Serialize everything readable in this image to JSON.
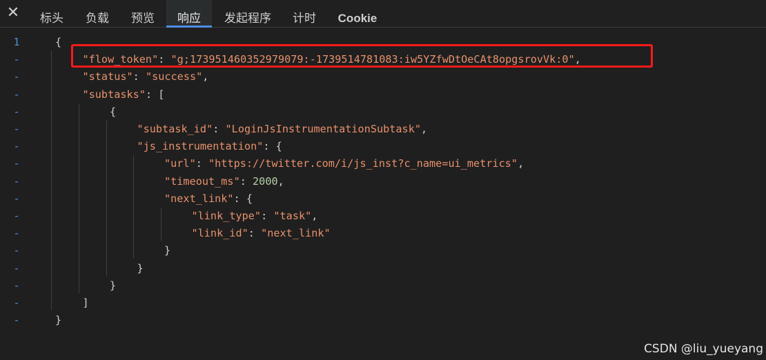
{
  "tabs": {
    "close_glyph": "✕",
    "items": [
      "标头",
      "负载",
      "预览",
      "响应",
      "发起程序",
      "计时",
      "Cookie"
    ],
    "active": "响应"
  },
  "gutter": {
    "first": "1",
    "fold": "-"
  },
  "json_lines": [
    {
      "indent": 0,
      "parts": [
        [
          "p",
          "{"
        ]
      ]
    },
    {
      "indent": 1,
      "parts": [
        [
          "k",
          "\"flow_token\""
        ],
        [
          "p",
          ": "
        ],
        [
          "s",
          "\"g;173951460352979079:-1739514781083:iw5YZfwDtOeCAt8opgsrovVk:0\""
        ],
        [
          "p",
          ","
        ]
      ]
    },
    {
      "indent": 1,
      "parts": [
        [
          "k",
          "\"status\""
        ],
        [
          "p",
          ": "
        ],
        [
          "s",
          "\"success\""
        ],
        [
          "p",
          ","
        ]
      ]
    },
    {
      "indent": 1,
      "parts": [
        [
          "k",
          "\"subtasks\""
        ],
        [
          "p",
          ": ["
        ]
      ]
    },
    {
      "indent": 2,
      "parts": [
        [
          "p",
          "{"
        ]
      ]
    },
    {
      "indent": 3,
      "parts": [
        [
          "k",
          "\"subtask_id\""
        ],
        [
          "p",
          ": "
        ],
        [
          "s",
          "\"LoginJsInstrumentationSubtask\""
        ],
        [
          "p",
          ","
        ]
      ]
    },
    {
      "indent": 3,
      "parts": [
        [
          "k",
          "\"js_instrumentation\""
        ],
        [
          "p",
          ": {"
        ]
      ]
    },
    {
      "indent": 4,
      "parts": [
        [
          "k",
          "\"url\""
        ],
        [
          "p",
          ": "
        ],
        [
          "s",
          "\"https://twitter.com/i/js_inst?c_name=ui_metrics\""
        ],
        [
          "p",
          ","
        ]
      ]
    },
    {
      "indent": 4,
      "parts": [
        [
          "k",
          "\"timeout_ms\""
        ],
        [
          "p",
          ": "
        ],
        [
          "n",
          "2000"
        ],
        [
          "p",
          ","
        ]
      ]
    },
    {
      "indent": 4,
      "parts": [
        [
          "k",
          "\"next_link\""
        ],
        [
          "p",
          ": {"
        ]
      ]
    },
    {
      "indent": 5,
      "parts": [
        [
          "k",
          "\"link_type\""
        ],
        [
          "p",
          ": "
        ],
        [
          "s",
          "\"task\""
        ],
        [
          "p",
          ","
        ]
      ]
    },
    {
      "indent": 5,
      "parts": [
        [
          "k",
          "\"link_id\""
        ],
        [
          "p",
          ": "
        ],
        [
          "s",
          "\"next_link\""
        ]
      ]
    },
    {
      "indent": 4,
      "parts": [
        [
          "p",
          "}"
        ]
      ]
    },
    {
      "indent": 3,
      "parts": [
        [
          "p",
          "}"
        ]
      ]
    },
    {
      "indent": 2,
      "parts": [
        [
          "p",
          "}"
        ]
      ]
    },
    {
      "indent": 1,
      "parts": [
        [
          "p",
          "]"
        ]
      ]
    },
    {
      "indent": 0,
      "parts": [
        [
          "p",
          "}"
        ]
      ]
    }
  ],
  "watermark": "CSDN @liu_yueyang",
  "colors": {
    "background": "#1f1f1f",
    "key_string": "#e8916c",
    "number": "#b5cea8",
    "active_tab_underline": "#4d8ee6",
    "highlight_box": "#ff1a1a"
  }
}
